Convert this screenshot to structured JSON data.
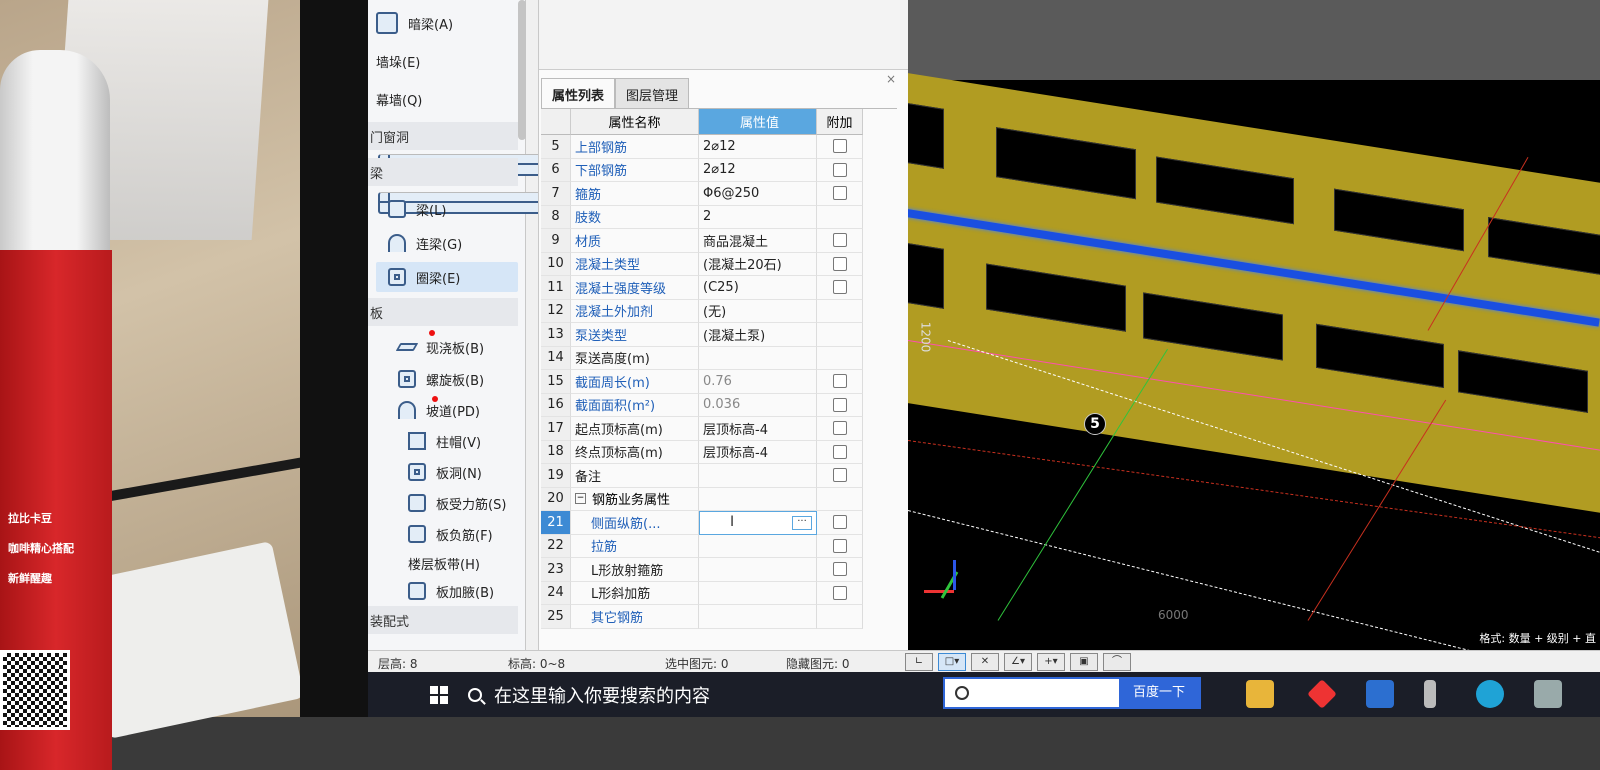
{
  "tool_panel": {
    "top_items": [
      {
        "label": "暗梁(A)",
        "icon": "hidden-beam-icon"
      },
      {
        "label": "墙垛(E)",
        "icon": "wall-pier-icon"
      },
      {
        "label": "幕墙(Q)",
        "icon": "curtain-wall-icon"
      }
    ],
    "groups": {
      "doors": "门窗洞",
      "beam": "梁",
      "slab": "板",
      "prefab": "装配式"
    },
    "beam_items": [
      {
        "label": "梁(L)",
        "icon": "beam-icon"
      },
      {
        "label": "连梁(G)",
        "icon": "coupling-beam-icon"
      },
      {
        "label": "圈梁(E)",
        "icon": "ring-beam-icon"
      }
    ],
    "slab_items": [
      {
        "label": "现浇板(B)",
        "icon": "cast-slab-icon"
      },
      {
        "label": "螺旋板(B)",
        "icon": "spiral-slab-icon"
      },
      {
        "label": "坡道(PD)",
        "icon": "ramp-icon"
      },
      {
        "label": "柱帽(V)",
        "icon": "column-cap-icon"
      },
      {
        "label": "板洞(N)",
        "icon": "slab-hole-icon"
      },
      {
        "label": "板受力筋(S)",
        "icon": "slab-main-rebar-icon"
      },
      {
        "label": "板负筋(F)",
        "icon": "slab-neg-rebar-icon"
      },
      {
        "label": "楼层板带(H)",
        "icon": "floor-strip-icon"
      },
      {
        "label": "板加腋(B)",
        "icon": "slab-haunch-icon"
      }
    ]
  },
  "property_panel": {
    "tabs": [
      "属性列表",
      "图层管理"
    ],
    "close": "×",
    "headers": {
      "name": "属性名称",
      "value": "属性值",
      "extra": "附加"
    },
    "rows": [
      {
        "num": "5",
        "name": "上部钢筋",
        "value": "2⌀12",
        "style": "blue",
        "check": true
      },
      {
        "num": "6",
        "name": "下部钢筋",
        "value": "2⌀12",
        "style": "blue",
        "check": true
      },
      {
        "num": "7",
        "name": "箍筋",
        "value": "Φ6@250",
        "style": "blue",
        "check": true
      },
      {
        "num": "8",
        "name": "肢数",
        "value": "2",
        "style": "blue",
        "check": false
      },
      {
        "num": "9",
        "name": "材质",
        "value": "商品混凝土",
        "style": "blue",
        "check": true
      },
      {
        "num": "10",
        "name": "混凝土类型",
        "value": "(混凝土20石)",
        "style": "blue",
        "check": true
      },
      {
        "num": "11",
        "name": "混凝土强度等级",
        "value": "(C25)",
        "style": "blue",
        "check": true
      },
      {
        "num": "12",
        "name": "混凝土外加剂",
        "value": "(无)",
        "style": "blue",
        "check": false
      },
      {
        "num": "13",
        "name": "泵送类型",
        "value": "(混凝土泵)",
        "style": "blue",
        "check": false
      },
      {
        "num": "14",
        "name": "泵送高度(m)",
        "value": "",
        "style": "black",
        "check": false
      },
      {
        "num": "15",
        "name": "截面周长(m)",
        "value": "0.76",
        "style": "blue",
        "valgray": true,
        "check": true
      },
      {
        "num": "16",
        "name": "截面面积(m²)",
        "value": "0.036",
        "style": "blue",
        "valgray": true,
        "check": true
      },
      {
        "num": "17",
        "name": "起点顶标高(m)",
        "value": "层顶标高-4",
        "style": "black",
        "check": true
      },
      {
        "num": "18",
        "name": "终点顶标高(m)",
        "value": "层顶标高-4",
        "style": "black",
        "check": true
      },
      {
        "num": "19",
        "name": "备注",
        "value": "",
        "style": "black",
        "check": true
      },
      {
        "num": "20",
        "name": "钢筋业务属性",
        "value": "",
        "style": "group",
        "check": false
      },
      {
        "num": "21",
        "name": "侧面纵筋(...",
        "value": "",
        "style": "blue-indent",
        "check": true,
        "editing": true
      },
      {
        "num": "22",
        "name": "拉筋",
        "value": "",
        "style": "blue-indent",
        "check": true
      },
      {
        "num": "23",
        "name": "L形放射箍筋",
        "value": "",
        "style": "black-indent",
        "check": true
      },
      {
        "num": "24",
        "name": "L形斜加筋",
        "value": "",
        "style": "black-indent",
        "check": true
      },
      {
        "num": "25",
        "name": "其它钢筋",
        "value": "",
        "style": "blue-indent",
        "check": false
      }
    ],
    "collapse_symbol": "−",
    "ellipsis": "···",
    "text_cursor": "I"
  },
  "status_bar": {
    "floor_height": "层高:  8",
    "elevation": "标高:  0~8",
    "selected": "选中图元:  0",
    "hidden": "隐藏图元:  0"
  },
  "viewport": {
    "axis_label": "5",
    "bottom_text": "格式: 数量 + 级别 + 直",
    "side_label": "1200",
    "dim_label": "6000",
    "colors": {
      "wall": "#b19c22",
      "beam": "#1a4fe0",
      "grid_line": "#e33",
      "green_line": "#2fc43c"
    }
  },
  "taskbar": {
    "search_placeholder": "在这里输入你要搜索的内容",
    "baidu_button": "百度一下"
  },
  "cup": {
    "text1": "拉比卡豆",
    "text2": "咖啡精心搭配",
    "text3": "新鲜醒趣"
  }
}
